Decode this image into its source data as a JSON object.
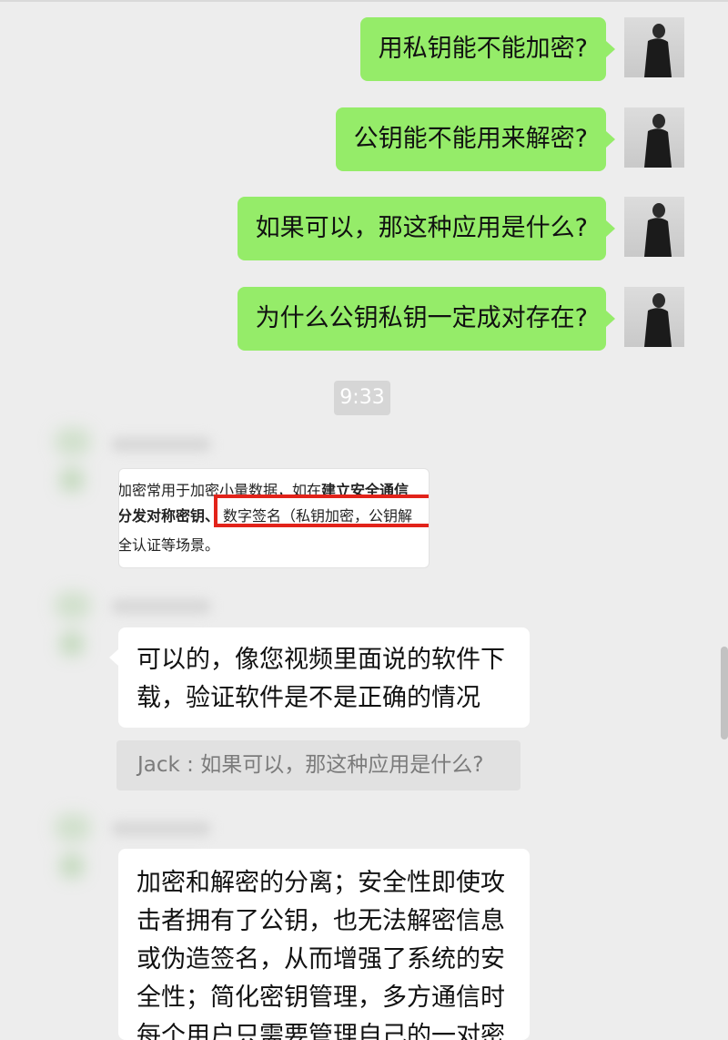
{
  "sent_messages": [
    "用私钥能不能加密?",
    "公钥能不能用来解密?",
    "如果可以，那这种应用是什么?",
    "为什么公钥私钥一定成对存在?"
  ],
  "timestamp": "9:33",
  "image_message": {
    "line1_prefix": "加密常用于加密小量数据，如在",
    "line1_bold": "建立安全通信",
    "line2": "分发对称密钥、",
    "highlight": "数字签名（私钥加密，公钥解",
    "line3": "全认证等场景。"
  },
  "reply1": {
    "text_line1": "可以的，像您视频里面说的软件下",
    "text_line2": "载，验证软件是不是正确的情况",
    "quote": "Jack : 如果可以，那这种应用是什么?"
  },
  "reply2": {
    "lines": [
      "加密和解密的分离；安全性即使攻",
      "击者拥有了公钥，也无法解密信息",
      "或伪造签名，从而增强了系统的安",
      "全性；简化密钥管理，多方通信时",
      "每个用户只需要管理自己的一对密"
    ]
  },
  "colors": {
    "background": "#ededed",
    "sent_bubble": "#95ec69",
    "received_bubble": "#ffffff",
    "highlight_border": "#e2231a"
  }
}
